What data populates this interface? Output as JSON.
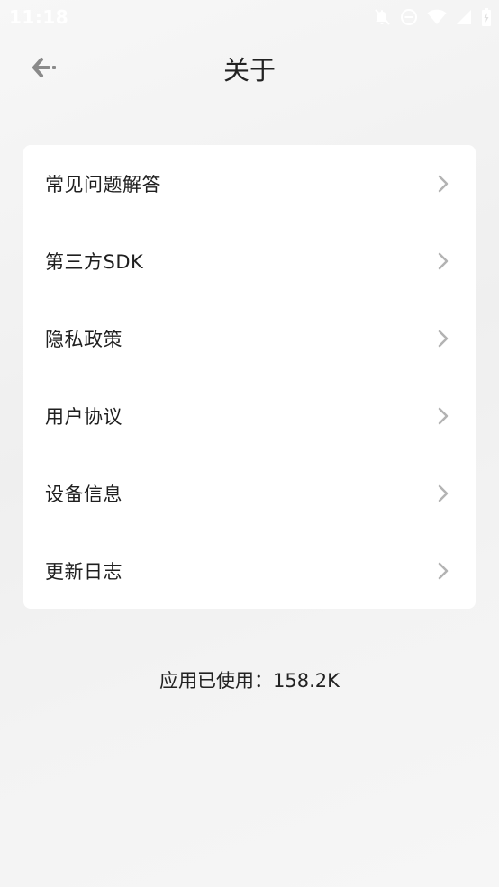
{
  "status_bar": {
    "time": "11:18",
    "icons": [
      "notifications-off-icon",
      "do-not-disturb-icon",
      "wifi-icon",
      "signal-icon",
      "battery-icon"
    ]
  },
  "header": {
    "title": "关于",
    "back_icon": "back-arrow-icon"
  },
  "menu": {
    "items": [
      {
        "label": "常见问题解答"
      },
      {
        "label": "第三方SDK"
      },
      {
        "label": "隐私政策"
      },
      {
        "label": "用户协议"
      },
      {
        "label": "设备信息"
      },
      {
        "label": "更新日志"
      }
    ],
    "chevron_icon": "chevron-right-icon"
  },
  "footer": {
    "usage": "应用已使用：158.2K"
  },
  "colors": {
    "background": "#f2f2f2",
    "card": "#ffffff",
    "text": "#222222",
    "chevron": "#b3b3b3",
    "back_arrow": "#8a8a8a"
  }
}
